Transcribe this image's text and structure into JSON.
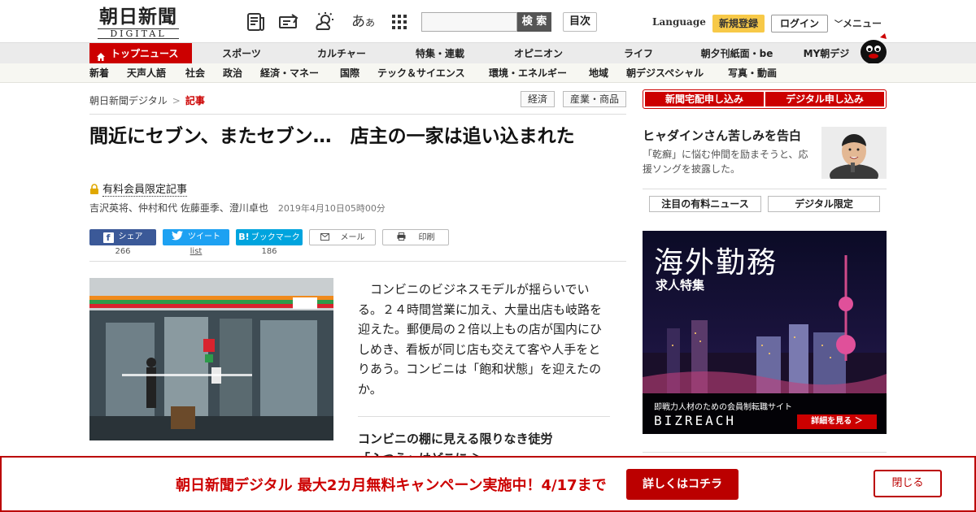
{
  "header": {
    "logo_main": "朝日新聞",
    "logo_sub": "DIGITAL",
    "font_size_glyph_large": "あ",
    "font_size_glyph_small": "あ",
    "search_button": "検 索",
    "toc_button": "目次",
    "language": "Language",
    "register": "新規登録",
    "login": "ログイン",
    "menu": "メニュー"
  },
  "nav_primary": [
    "トップニュース",
    "スポーツ",
    "カルチャー",
    "特集・連載",
    "オピニオン",
    "ライフ",
    "朝夕刊紙面・be",
    "MY朝デジ"
  ],
  "nav_secondary": [
    "新着",
    "天声人語",
    "社会",
    "政治",
    "経済・マネー",
    "国際",
    "テック＆サイエンス",
    "環境・エネルギー",
    "地域",
    "朝デジスペシャル",
    "写真・動画"
  ],
  "breadcrumb": {
    "home": "朝日新聞デジタル",
    "separator": ">",
    "current": "記事"
  },
  "tags": [
    "経済",
    "産業・商品"
  ],
  "article": {
    "title": "間近にセブン、またセブン…　店主の一家は追い込まれた",
    "paid_label": "有料会員限定記事",
    "authors": "吉沢英将、仲村和代 佐藤亜季、澄川卓也",
    "date": "2019年4月10日05時00分",
    "body": "コンビニのビジネスモデルが揺らいでいる。２４時間営業に加え、大量出店も岐路を迎えた。郵便局の２倍以上もの店が国内にひしめき、看板が同じ店も交えて客や人手をとりあう。コンビニは「飽和状態」を迎えたのか。",
    "related_title": "コンビニの棚に見える限りなき徒労",
    "related_title_2": "「ふつう」はどこに"
  },
  "share": [
    {
      "label": "シェア",
      "count": "266",
      "icon": "f",
      "color": "#3b5998"
    },
    {
      "label": "ツイート",
      "count": "list",
      "icon": "bird",
      "color": "#1da1f2"
    },
    {
      "label": "ブックマーク",
      "count": "186",
      "icon": "B!",
      "color": "#00a4de"
    },
    {
      "label": "メール",
      "icon": "mail-icon"
    },
    {
      "label": "印刷",
      "icon": "print-icon"
    }
  ],
  "sidebar": {
    "subscribe_paper": "新聞宅配申し込み",
    "subscribe_digital": "デジタル申し込み",
    "promo_title": "ヒャダインさん苦しみを告白",
    "promo_text": "「乾癬」に悩む仲間を励まそうと、応援ソングを披露した。",
    "tab_paid_news": "注目の有料ニュース",
    "tab_digital_only": "デジタル限定",
    "ad": {
      "title": "海外勤務",
      "subtitle": "求人特集",
      "tagline": "即戦力人材のための会員制転職サイト",
      "brand": "BIZREACH",
      "cta": "詳細を見る ＞"
    }
  },
  "banner": {
    "text": "朝日新聞デジタル 最大2カ月無料キャンペーン実施中！4/17まで",
    "cta": "詳しくはコチラ",
    "close": "閉じる"
  },
  "colors": {
    "brand_red": "#cc0000",
    "nav_bg": "#ebebeb",
    "register_yellow": "#f7c948"
  }
}
